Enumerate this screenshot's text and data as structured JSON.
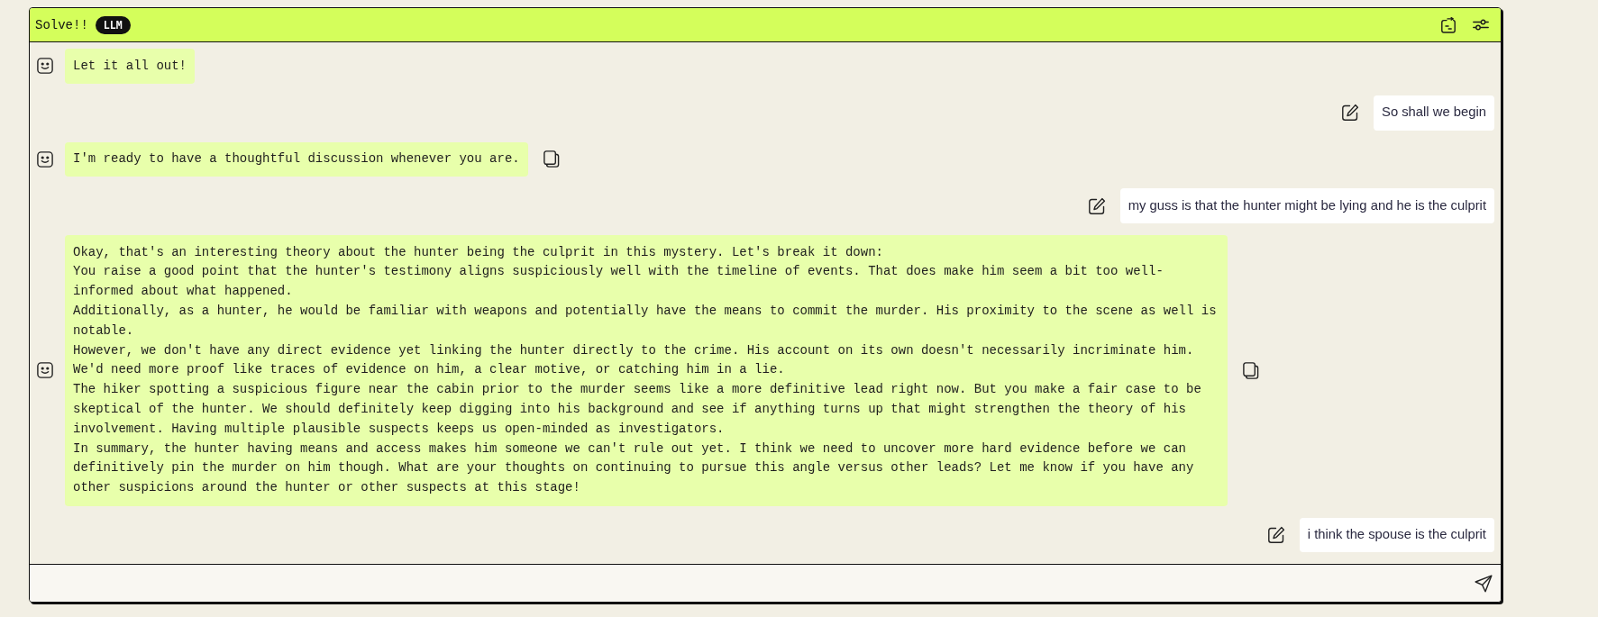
{
  "header": {
    "title": "Solve!!",
    "badge": "LLM"
  },
  "messages": [
    {
      "kind": "bot",
      "text": "Let it all out!",
      "copyable": false
    },
    {
      "kind": "user",
      "text": "So shall we begin"
    },
    {
      "kind": "bot",
      "text": "I'm ready to have a thoughtful discussion whenever you are.",
      "copyable": true
    },
    {
      "kind": "user",
      "text": "my guss is that the hunter might be lying and he is the culprit"
    },
    {
      "kind": "bot",
      "text": "Okay, that's an interesting theory about the hunter being the culprit in this mystery. Let's break it down:\nYou raise a good point that the hunter's testimony aligns suspiciously well with the timeline of events. That does make him seem a bit too well-informed about what happened.\nAdditionally, as a hunter, he would be familiar with weapons and potentially have the means to commit the murder. His proximity to the scene as well is notable.\nHowever, we don't have any direct evidence yet linking the hunter directly to the crime. His account on its own doesn't necessarily incriminate him. We'd need more proof like traces of evidence on him, a clear motive, or catching him in a lie.\nThe hiker spotting a suspicious figure near the cabin prior to the murder seems like a more definitive lead right now. But you make a fair case to be skeptical of the hunter. We should definitely keep digging into his background and see if anything turns up that might strengthen the theory of his involvement. Having multiple plausible suspects keeps us open-minded as investigators.\nIn summary, the hunter having means and access makes him someone we can't rule out yet. I think we need to uncover more hard evidence before we can definitively pin the murder on him though. What are your thoughts on continuing to pursue this angle versus other leads? Let me know if you have any other suspicions around the hunter or other suspects at this stage!",
      "copyable": true
    },
    {
      "kind": "user",
      "text": "i think the spouse is the culprit"
    }
  ]
}
